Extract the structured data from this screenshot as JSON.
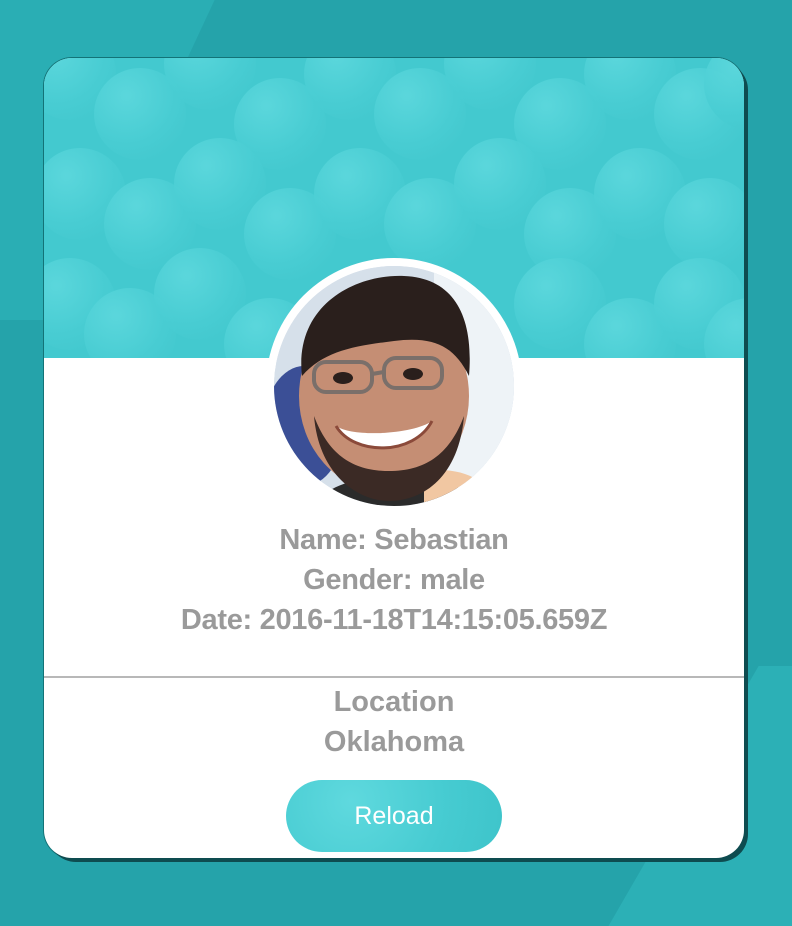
{
  "profile": {
    "name_line": "Name: Sebastian",
    "gender_line": "Gender: male",
    "date_line": "Date: 2016-11-18T14:15:05.659Z",
    "location_heading": "Location",
    "location_value": "Oklahoma"
  },
  "actions": {
    "reload_label": "Reload"
  },
  "colors": {
    "background": "#25a3aa",
    "banner": "#43c9cf",
    "text": "#9a9a9a",
    "button_text": "#ffffff"
  },
  "icons": {
    "avatar": "avatar-photo"
  }
}
